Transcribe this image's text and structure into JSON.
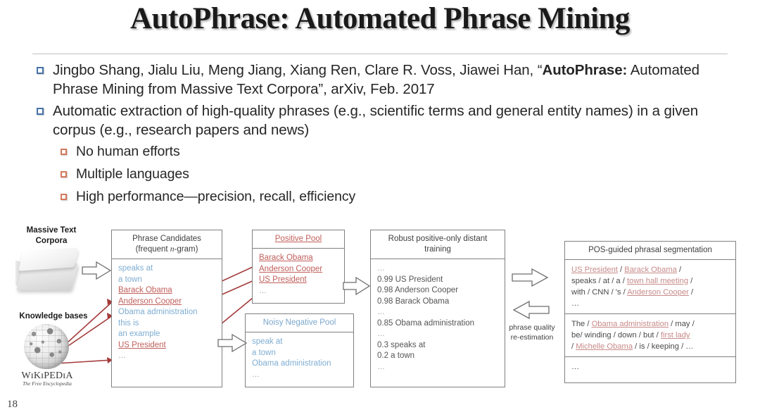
{
  "slide": {
    "title": "AutoPhrase: Automated Phrase Mining",
    "page_number": "18"
  },
  "bullets": [
    {
      "level": 1,
      "marker_color": "#4472a8",
      "text_before": "Jingbo Shang, Jialu Liu, Meng Jiang, Xiang Ren, Clare R. Voss, Jiawei Han, “",
      "text_bold": "AutoPhrase:",
      "text_after": " Automated Phrase Mining from Massive Text Corpora”, arXiv, Feb. 2017"
    },
    {
      "level": 1,
      "marker_color": "#4472a8",
      "text": "Automatic extraction of high-quality phrases (e.g., scientific terms and general entity names) in a given corpus (e.g., research papers and news)"
    },
    {
      "level": 2,
      "marker_color": "#d4795b",
      "text": "No human efforts"
    },
    {
      "level": 2,
      "marker_color": "#d4795b",
      "text": "Multiple languages"
    },
    {
      "level": 2,
      "marker_color": "#d4795b",
      "text": "High performance—precision, recall, efficiency"
    }
  ],
  "diagram": {
    "sources": {
      "corpora_label_line1": "Massive Text",
      "corpora_label_line2": "Corpora",
      "knowledge_label": "Knowledge bases",
      "wikipedia_wordmark": "WɪKɪPEDɪA",
      "wikipedia_tagline": "The Free Encyclopedia"
    },
    "phrase_candidates": {
      "header_line1": "Phrase Candidates",
      "header_line2_pre": "(frequent ",
      "header_line2_var": "n",
      "header_line2_post": "-gram)",
      "items": [
        {
          "text": "speaks at",
          "style": "blue"
        },
        {
          "text": "a town",
          "style": "blue"
        },
        {
          "text": "Barack Obama",
          "style": "red"
        },
        {
          "text": "Anderson Cooper",
          "style": "red"
        },
        {
          "text": "Obama administration",
          "style": "blue"
        },
        {
          "text": "this is",
          "style": "blue"
        },
        {
          "text": "an example",
          "style": "blue"
        },
        {
          "text": "US President",
          "style": "red"
        },
        {
          "text": "…",
          "style": "dots"
        }
      ]
    },
    "positive_pool": {
      "header": "Positive Pool",
      "items": [
        {
          "text": "Barack Obama",
          "style": "red"
        },
        {
          "text": "Anderson Cooper",
          "style": "red"
        },
        {
          "text": "US President",
          "style": "red"
        },
        {
          "text": "…",
          "style": "dots"
        }
      ]
    },
    "negative_pool": {
      "header": "Noisy Negative Pool",
      "items": [
        {
          "text": "speak at",
          "style": "blue"
        },
        {
          "text": "a town",
          "style": "blue"
        },
        {
          "text": "Obama administration",
          "style": "blue"
        },
        {
          "text": "…",
          "style": "dots"
        }
      ]
    },
    "distant_training": {
      "header_line1": "Robust positive-only distant",
      "header_line2": "training",
      "items": [
        {
          "text": "…",
          "style": "dots"
        },
        {
          "text": "0.99 US President",
          "style": "gray"
        },
        {
          "text": "0.98 Anderson Cooper",
          "style": "gray"
        },
        {
          "text": "0.98 Barack Obama",
          "style": "gray"
        },
        {
          "text": "…",
          "style": "dots"
        },
        {
          "text": "0.85 Obama administration",
          "style": "gray"
        },
        {
          "text": "…",
          "style": "dots"
        },
        {
          "text": "0.3 speaks at",
          "style": "gray"
        },
        {
          "text": "0.2 a town",
          "style": "gray"
        },
        {
          "text": "…",
          "style": "dots"
        }
      ]
    },
    "feedback": {
      "label_line1": "phrase quality",
      "label_line2": "re-estimation"
    },
    "segmentation": {
      "header": "POS-guided phrasal segmentation",
      "block1": [
        [
          {
            "t": "US President",
            "s": "red"
          },
          {
            "t": " / ",
            "s": "plain"
          },
          {
            "t": "Barack Obama",
            "s": "red"
          },
          {
            "t": " /",
            "s": "plain"
          }
        ],
        [
          {
            "t": "speaks / at / a / ",
            "s": "plain"
          },
          {
            "t": "town  hall meeting",
            "s": "red"
          },
          {
            "t": " /",
            "s": "plain"
          }
        ],
        [
          {
            "t": "with / CNN / 's / ",
            "s": "plain"
          },
          {
            "t": "Anderson Cooper",
            "s": "red"
          },
          {
            "t": " /",
            "s": "plain"
          }
        ],
        [
          {
            "t": "…",
            "s": "dots"
          }
        ]
      ],
      "block2": [
        [
          {
            "t": "The / ",
            "s": "plain"
          },
          {
            "t": "Obama administration",
            "s": "red"
          },
          {
            "t": " / may /",
            "s": "plain"
          }
        ],
        [
          {
            "t": "be/ winding / down / but / ",
            "s": "plain"
          },
          {
            "t": "first lady",
            "s": "red"
          }
        ],
        [
          {
            "t": "/ ",
            "s": "plain"
          },
          {
            "t": "Michelle Obama",
            "s": "red"
          },
          {
            "t": " / is / keeping /  …",
            "s": "plain"
          }
        ]
      ],
      "block3": [
        [
          {
            "t": "…",
            "s": "dots"
          }
        ]
      ]
    }
  },
  "colors": {
    "bullet_blue": "#4472a8",
    "bullet_orange": "#d4795b",
    "phrase_blue": "#7fadd2",
    "phrase_red": "#c0605c",
    "box_border": "#808080",
    "connector_red": "#a33a3a"
  }
}
